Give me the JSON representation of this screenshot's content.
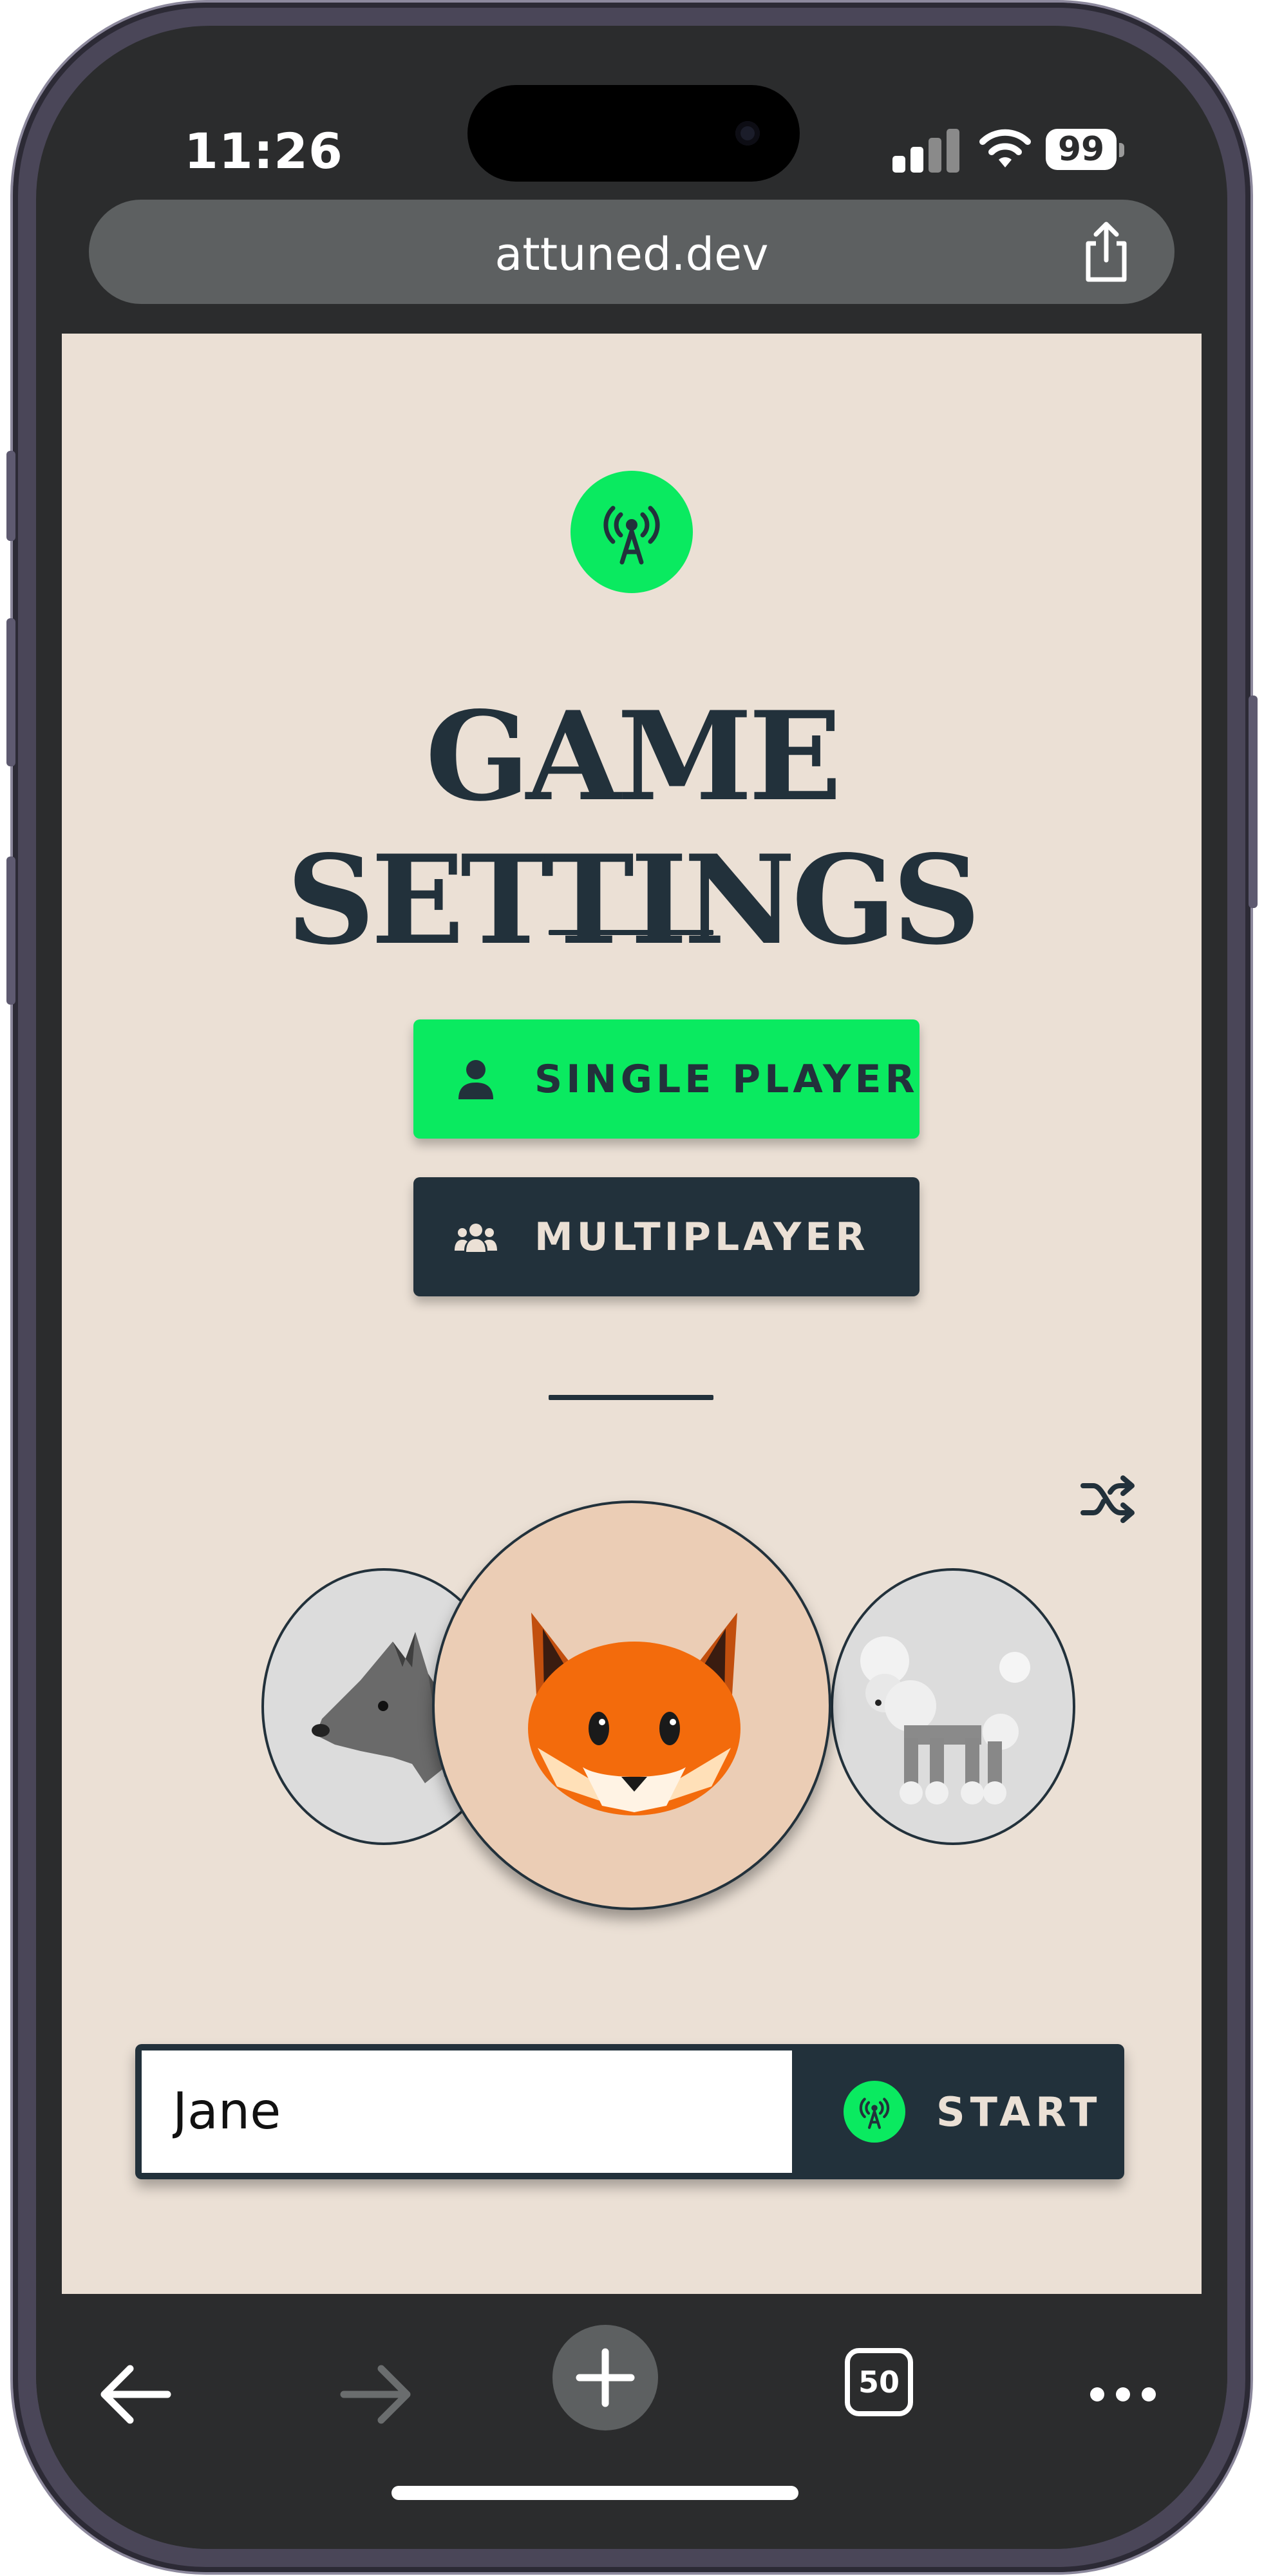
{
  "status_bar": {
    "time": "11:26",
    "battery": "99",
    "icons": [
      "signal-icon",
      "wifi-icon",
      "battery-icon"
    ]
  },
  "browser": {
    "url": "attuned.dev",
    "share_icon": "share-icon"
  },
  "page": {
    "logo_icon": "antenna-icon",
    "title": "GAME SETTINGS",
    "modes": [
      {
        "label": "SINGLE PLAYER",
        "icon": "person-icon",
        "selected": true
      },
      {
        "label": "MULTIPLAYER",
        "icon": "group-icon",
        "selected": false
      }
    ],
    "shuffle_icon": "shuffle-icon",
    "avatars": [
      {
        "name": "wolf",
        "selected": false
      },
      {
        "name": "fox",
        "selected": true
      },
      {
        "name": "poodle",
        "selected": false
      }
    ],
    "name_value": "Jane",
    "start_label": "START"
  },
  "toolbar": {
    "tabs_count": "50",
    "icons": [
      "back-icon",
      "forward-icon",
      "new-tab-icon",
      "tabs-icon",
      "more-icon"
    ]
  },
  "colors": {
    "accent_green": "#0aea60",
    "dark_navy": "#22313b",
    "page_background": "#ebe0d5",
    "avatar_selected_bg": "#ebcdb5",
    "avatar_unselected_bg": "#dcdcdc"
  }
}
